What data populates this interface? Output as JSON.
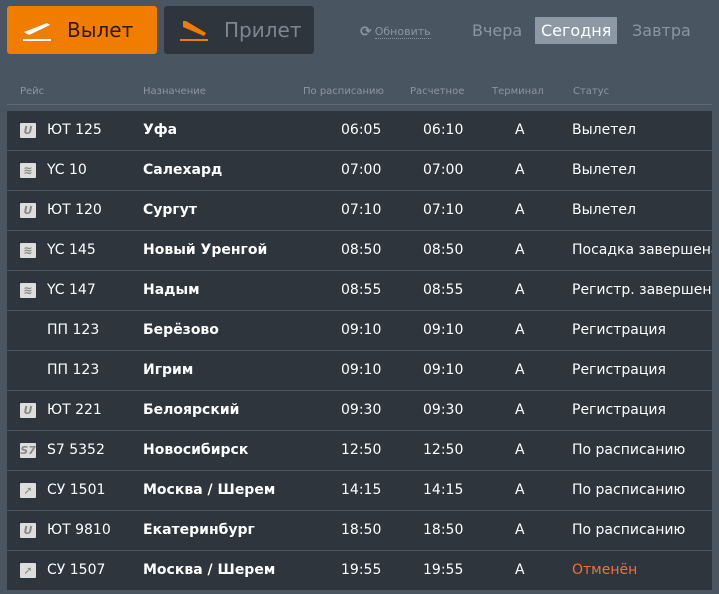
{
  "tabs": {
    "departure": "Вылет",
    "arrival": "Прилет"
  },
  "refresh": "Обновить",
  "days": {
    "yesterday": "Вчера",
    "today": "Сегодня",
    "tomorrow": "Завтра"
  },
  "headers": {
    "flight": "Рейс",
    "destination": "Назначение",
    "scheduled": "По расписанию",
    "estimated": "Расчетное",
    "terminal": "Терминал",
    "status": "Статус"
  },
  "colors": {
    "accent": "#f07c00",
    "cancelled": "#f0703c"
  },
  "rows": [
    {
      "icon": "utair-logo",
      "flight": "ЮТ 125",
      "dest": "Уфа",
      "sched": "06:05",
      "est": "06:10",
      "term": "A",
      "status": "Вылетел"
    },
    {
      "icon": "yamal-logo",
      "flight": "YC 10",
      "dest": "Салехард",
      "sched": "07:00",
      "est": "07:00",
      "term": "A",
      "status": "Вылетел"
    },
    {
      "icon": "utair-logo",
      "flight": "ЮТ 120",
      "dest": "Сургут",
      "sched": "07:10",
      "est": "07:10",
      "term": "A",
      "status": "Вылетел"
    },
    {
      "icon": "yamal-logo",
      "flight": "YC 145",
      "dest": "Новый Уренгой",
      "sched": "08:50",
      "est": "08:50",
      "term": "A",
      "status": "Посадка завершена"
    },
    {
      "icon": "yamal-logo",
      "flight": "YC 147",
      "dest": "Надым",
      "sched": "08:55",
      "est": "08:55",
      "term": "A",
      "status": "Регистр. завершена"
    },
    {
      "icon": "",
      "flight": "ПП 123",
      "dest": "Берёзово",
      "sched": "09:10",
      "est": "09:10",
      "term": "A",
      "status": "Регистрация"
    },
    {
      "icon": "",
      "flight": "ПП 123",
      "dest": "Игрим",
      "sched": "09:10",
      "est": "09:10",
      "term": "A",
      "status": "Регистрация"
    },
    {
      "icon": "utair-logo",
      "flight": "ЮТ 221",
      "dest": "Белоярский",
      "sched": "09:30",
      "est": "09:30",
      "term": "A",
      "status": "Регистрация"
    },
    {
      "icon": "s7-logo",
      "flight": "S7 5352",
      "dest": "Новосибирск",
      "sched": "12:50",
      "est": "12:50",
      "term": "A",
      "status": "По расписанию"
    },
    {
      "icon": "aeroflot-logo",
      "flight": "СУ 1501",
      "dest": "Москва / Шерем",
      "sched": "14:15",
      "est": "14:15",
      "term": "A",
      "status": "По расписанию"
    },
    {
      "icon": "utair-logo",
      "flight": "ЮТ 9810",
      "dest": "Екатеринбург",
      "sched": "18:50",
      "est": "18:50",
      "term": "A",
      "status": "По расписанию"
    },
    {
      "icon": "aeroflot-logo",
      "flight": "СУ 1507",
      "dest": "Москва / Шерем",
      "sched": "19:55",
      "est": "19:55",
      "term": "A",
      "status": "Отменён",
      "cancelled": true
    }
  ]
}
